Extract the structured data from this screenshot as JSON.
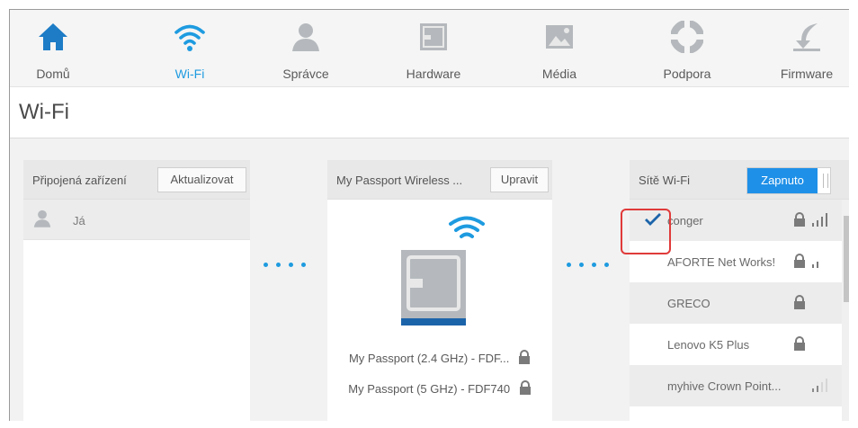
{
  "nav": {
    "items": [
      {
        "label": "Domů",
        "icon": "home-icon"
      },
      {
        "label": "Wi-Fi",
        "icon": "wifi-icon"
      },
      {
        "label": "Správce",
        "icon": "user-icon"
      },
      {
        "label": "Hardware",
        "icon": "hardware-icon"
      },
      {
        "label": "Média",
        "icon": "media-icon"
      },
      {
        "label": "Podpora",
        "icon": "support-icon"
      },
      {
        "label": "Firmware",
        "icon": "firmware-icon"
      }
    ]
  },
  "page": {
    "title": "Wi-Fi"
  },
  "connected": {
    "title": "Připojená zařízení",
    "refresh_label": "Aktualizovat",
    "devices": [
      {
        "name": "Já"
      }
    ]
  },
  "device": {
    "title": "My Passport Wireless ...",
    "edit_label": "Upravit",
    "ssids": [
      {
        "name": "My Passport (2.4 GHz) - FDF..."
      },
      {
        "name": "My Passport (5 GHz) - FDF740"
      }
    ]
  },
  "wifi": {
    "title": "Sítě Wi-Fi",
    "toggle_label": "Zapnuto",
    "networks": [
      {
        "name": "conger",
        "connected": true,
        "locked": true,
        "signal": 4
      },
      {
        "name": "AFORTE Net Works!",
        "connected": false,
        "locked": true,
        "signal": 1
      },
      {
        "name": "GRECO",
        "connected": false,
        "locked": true,
        "signal": 0
      },
      {
        "name": "Lenovo K5 Plus",
        "connected": false,
        "locked": true,
        "signal": 0
      },
      {
        "name": "myhive Crown Point...",
        "connected": false,
        "locked": false,
        "signal": 2
      }
    ]
  },
  "colors": {
    "accent": "#1e9be0",
    "icon_gray": "#b5b9bd",
    "marker": "#e03a3a"
  }
}
